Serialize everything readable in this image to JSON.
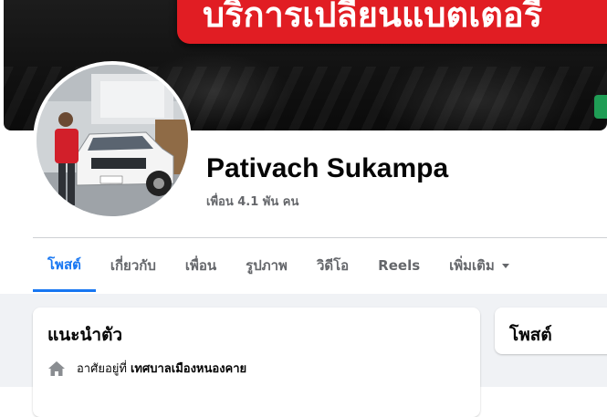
{
  "cover": {
    "banner_text": "บริการเปลี่ยนแบตเตอรี่"
  },
  "profile": {
    "name": "Pativach Sukampa",
    "friends": "เพื่อน 4.1 พัน คน"
  },
  "tabs": [
    {
      "label": "โพสต์",
      "active": true
    },
    {
      "label": "เกี่ยวกับ",
      "active": false
    },
    {
      "label": "เพื่อน",
      "active": false
    },
    {
      "label": "รูปภาพ",
      "active": false
    },
    {
      "label": "วิดีโอ",
      "active": false
    },
    {
      "label": "Reels",
      "active": false
    },
    {
      "label": "เพิ่มเติม",
      "active": false
    }
  ],
  "intro": {
    "title": "แนะนำตัว",
    "lives_in_prefix": "อาศัยอยู่ที่",
    "lives_in_place": "เทศบาลเมืองหนองคาย"
  },
  "posts_card": {
    "title": "โพสต์"
  },
  "colors": {
    "accent": "#1877f2",
    "banner": "#e11d23",
    "muted": "#65676b",
    "page_bg": "#f0f2f5"
  }
}
